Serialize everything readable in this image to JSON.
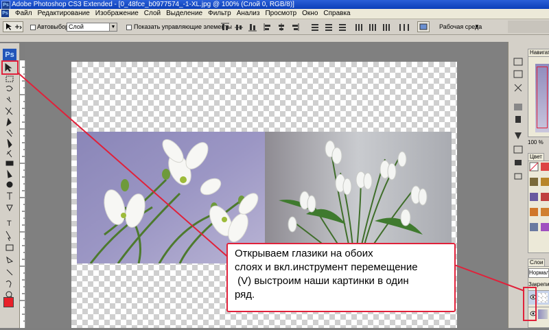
{
  "titlebar": {
    "title": "Adobe Photoshop CS3 Extended - [0_48fce_b0977574_-1-XL.jpg @ 100% (Слой 0, RGB/8)]",
    "icon_label": "Ps"
  },
  "menu": {
    "icon_label": "Ps",
    "items": [
      "Файл",
      "Редактирование",
      "Изображение",
      "Слой",
      "Выделение",
      "Фильтр",
      "Анализ",
      "Просмотр",
      "Окно",
      "Справка"
    ]
  },
  "options": {
    "autoselect_label": "Автовыбор:",
    "autoselect_value": "Слой",
    "show_controls_label": "Показать управляющие элементы",
    "workspace_label": "Рабочая среда"
  },
  "toolbox": {
    "logo": "Ps"
  },
  "right_panel": {
    "navigator_tab": "Навигат",
    "zoom_value": "100 %",
    "color_tab": "Цвет",
    "layers_tab": "Слои",
    "blend_mode": "Нормаль",
    "lock_label": "Закрепит"
  },
  "callout": {
    "lines": [
      "Открываем глазики на обоих",
      "слоях и вкл.инструмент перемещение",
      " (V) выстроим наши картинки в один",
      "ряд."
    ]
  },
  "colors": {
    "accent_red": "#e0213a",
    "title_blue": "#0b3fb8",
    "foreground_swatch": "#e8202a"
  }
}
